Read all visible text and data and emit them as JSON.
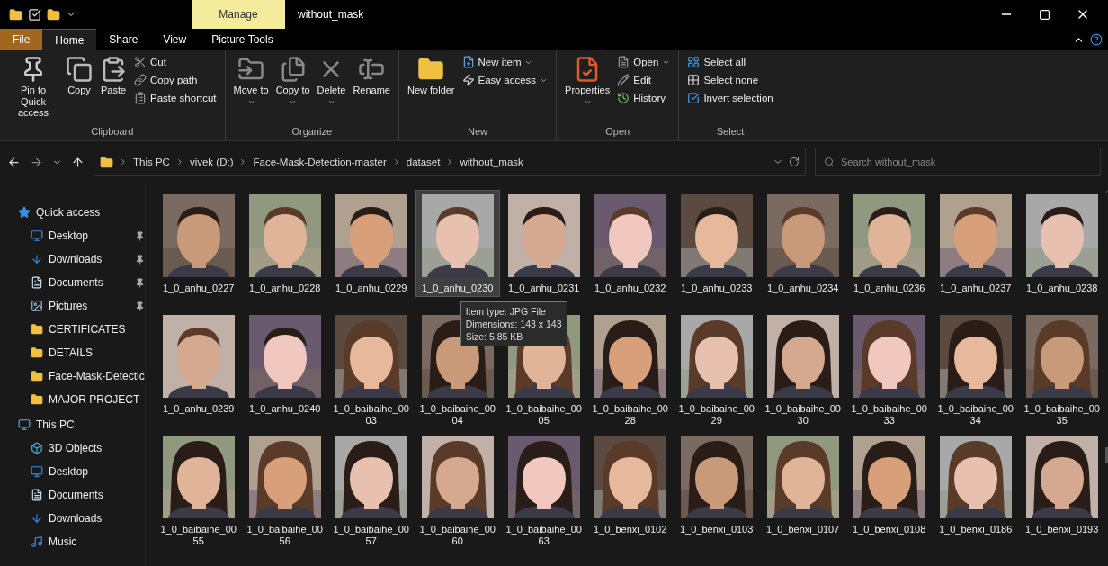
{
  "title_bar": {
    "context_tab": "Manage",
    "title": "without_mask"
  },
  "ribbon_tabs": [
    {
      "label": "File",
      "kind": "file",
      "selected": false
    },
    {
      "label": "Home",
      "kind": "tab",
      "selected": true
    },
    {
      "label": "Share",
      "kind": "tab",
      "selected": false
    },
    {
      "label": "View",
      "kind": "tab",
      "selected": false
    },
    {
      "label": "Picture Tools",
      "kind": "tab",
      "selected": false
    }
  ],
  "ribbon_groups": [
    {
      "label": "Clipboard",
      "items": [
        {
          "label": "Pin to Quick access",
          "kind": "large",
          "dropdown": false
        },
        {
          "label": "Copy",
          "kind": "large",
          "dropdown": false
        },
        {
          "label": "Paste",
          "kind": "large",
          "dropdown": false
        },
        {
          "label": "Cut",
          "kind": "small",
          "dropdown": false
        },
        {
          "label": "Copy path",
          "kind": "small",
          "dropdown": false
        },
        {
          "label": "Paste shortcut",
          "kind": "small",
          "dropdown": false
        }
      ]
    },
    {
      "label": "Organize",
      "items": [
        {
          "label": "Move to",
          "kind": "large",
          "dropdown": true
        },
        {
          "label": "Copy to",
          "kind": "large",
          "dropdown": true
        },
        {
          "label": "Delete",
          "kind": "large",
          "dropdown": true
        },
        {
          "label": "Rename",
          "kind": "large",
          "dropdown": false
        }
      ]
    },
    {
      "label": "New",
      "items": [
        {
          "label": "New folder",
          "kind": "large",
          "dropdown": false
        },
        {
          "label": "New item",
          "kind": "small",
          "dropdown": true
        },
        {
          "label": "Easy access",
          "kind": "small",
          "dropdown": true
        }
      ]
    },
    {
      "label": "Open",
      "items": [
        {
          "label": "Properties",
          "kind": "large",
          "dropdown": true
        },
        {
          "label": "Open",
          "kind": "small",
          "dropdown": true
        },
        {
          "label": "Edit",
          "kind": "small",
          "dropdown": false
        },
        {
          "label": "History",
          "kind": "small",
          "dropdown": false
        }
      ]
    },
    {
      "label": "Select",
      "items": [
        {
          "label": "Select all",
          "kind": "small",
          "dropdown": false
        },
        {
          "label": "Select none",
          "kind": "small",
          "dropdown": false
        },
        {
          "label": "Invert selection",
          "kind": "small",
          "dropdown": false
        }
      ]
    }
  ],
  "address_bar": {
    "path": [
      "This PC",
      "vivek (D:)",
      "Face-Mask-Detection-master",
      "dataset",
      "without_mask"
    ],
    "search_placeholder": "Search without_mask"
  },
  "navigation": [
    {
      "label": "Quick access",
      "children": [
        {
          "label": "Desktop",
          "pinned": true
        },
        {
          "label": "Downloads",
          "pinned": true
        },
        {
          "label": "Documents",
          "pinned": true
        },
        {
          "label": "Pictures",
          "pinned": true
        },
        {
          "label": "CERTIFICATES",
          "pinned": false
        },
        {
          "label": "DETAILS",
          "pinned": false
        },
        {
          "label": "Face-Mask-Detectic",
          "pinned": false
        },
        {
          "label": "MAJOR PROJECT",
          "pinned": false
        }
      ]
    },
    {
      "label": "This PC",
      "children": [
        {
          "label": "3D Objects",
          "pinned": false
        },
        {
          "label": "Desktop",
          "pinned": false
        },
        {
          "label": "Documents",
          "pinned": false
        },
        {
          "label": "Downloads",
          "pinned": false
        },
        {
          "label": "Music",
          "pinned": false
        }
      ]
    }
  ],
  "files": [
    {
      "name": "1_0_anhu_0227",
      "selected": false
    },
    {
      "name": "1_0_anhu_0228",
      "selected": false
    },
    {
      "name": "1_0_anhu_0229",
      "selected": false
    },
    {
      "name": "1_0_anhu_0230",
      "selected": true
    },
    {
      "name": "1_0_anhu_0231",
      "selected": false
    },
    {
      "name": "1_0_anhu_0232",
      "selected": false
    },
    {
      "name": "1_0_anhu_0233",
      "selected": false
    },
    {
      "name": "1_0_anhu_0234",
      "selected": false
    },
    {
      "name": "1_0_anhu_0236",
      "selected": false
    },
    {
      "name": "1_0_anhu_0237",
      "selected": false
    },
    {
      "name": "1_0_anhu_0238",
      "selected": false
    },
    {
      "name": "1_0_anhu_0239",
      "selected": false
    },
    {
      "name": "1_0_anhu_0240",
      "selected": false
    },
    {
      "name": "1_0_baibaihe_0003",
      "selected": false
    },
    {
      "name": "1_0_baibaihe_0004",
      "selected": false
    },
    {
      "name": "1_0_baibaihe_0005",
      "selected": false
    },
    {
      "name": "1_0_baibaihe_0028",
      "selected": false
    },
    {
      "name": "1_0_baibaihe_0029",
      "selected": false
    },
    {
      "name": "1_0_baibaihe_0030",
      "selected": false
    },
    {
      "name": "1_0_baibaihe_0033",
      "selected": false
    },
    {
      "name": "1_0_baibaihe_0034",
      "selected": false
    },
    {
      "name": "1_0_baibaihe_0035",
      "selected": false
    },
    {
      "name": "1_0_baibaihe_0055",
      "selected": false
    },
    {
      "name": "1_0_baibaihe_0056",
      "selected": false
    },
    {
      "name": "1_0_baibaihe_0057",
      "selected": false
    },
    {
      "name": "1_0_baibaihe_0060",
      "selected": false
    },
    {
      "name": "1_0_baibaihe_0063",
      "selected": false
    },
    {
      "name": "1_0_benxi_0102",
      "selected": false
    },
    {
      "name": "1_0_benxi_0103",
      "selected": false
    },
    {
      "name": "1_0_benxi_0107",
      "selected": false
    },
    {
      "name": "1_0_benxi_0108",
      "selected": false
    },
    {
      "name": "1_0_benxi_0186",
      "selected": false
    },
    {
      "name": "1_0_benxi_0193",
      "selected": false
    }
  ],
  "tooltip": {
    "lines": [
      "Item type: JPG File",
      "Dimensions: 143 x 143",
      "Size: 5.85 KB"
    ]
  }
}
